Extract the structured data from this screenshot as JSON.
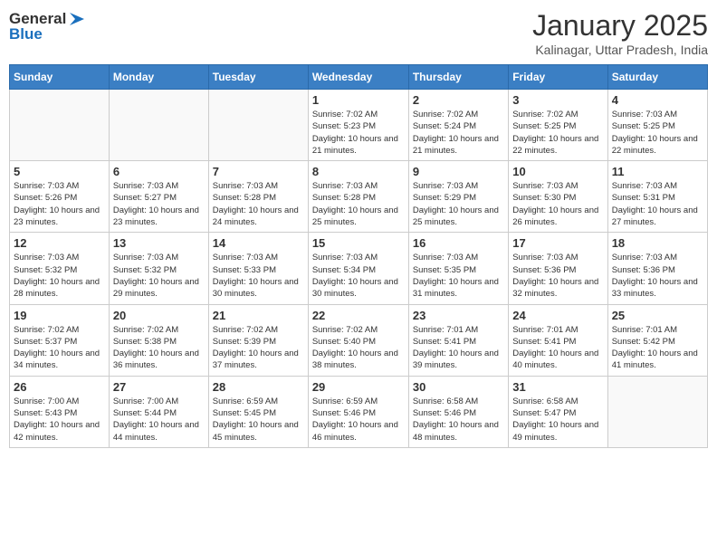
{
  "header": {
    "logo_general": "General",
    "logo_blue": "Blue",
    "title": "January 2025",
    "subtitle": "Kalinagar, Uttar Pradesh, India"
  },
  "weekdays": [
    "Sunday",
    "Monday",
    "Tuesday",
    "Wednesday",
    "Thursday",
    "Friday",
    "Saturday"
  ],
  "weeks": [
    [
      {
        "day": "",
        "sunrise": "",
        "sunset": "",
        "daylight": ""
      },
      {
        "day": "",
        "sunrise": "",
        "sunset": "",
        "daylight": ""
      },
      {
        "day": "",
        "sunrise": "",
        "sunset": "",
        "daylight": ""
      },
      {
        "day": "1",
        "sunrise": "Sunrise: 7:02 AM",
        "sunset": "Sunset: 5:23 PM",
        "daylight": "Daylight: 10 hours and 21 minutes."
      },
      {
        "day": "2",
        "sunrise": "Sunrise: 7:02 AM",
        "sunset": "Sunset: 5:24 PM",
        "daylight": "Daylight: 10 hours and 21 minutes."
      },
      {
        "day": "3",
        "sunrise": "Sunrise: 7:02 AM",
        "sunset": "Sunset: 5:25 PM",
        "daylight": "Daylight: 10 hours and 22 minutes."
      },
      {
        "day": "4",
        "sunrise": "Sunrise: 7:03 AM",
        "sunset": "Sunset: 5:25 PM",
        "daylight": "Daylight: 10 hours and 22 minutes."
      }
    ],
    [
      {
        "day": "5",
        "sunrise": "Sunrise: 7:03 AM",
        "sunset": "Sunset: 5:26 PM",
        "daylight": "Daylight: 10 hours and 23 minutes."
      },
      {
        "day": "6",
        "sunrise": "Sunrise: 7:03 AM",
        "sunset": "Sunset: 5:27 PM",
        "daylight": "Daylight: 10 hours and 23 minutes."
      },
      {
        "day": "7",
        "sunrise": "Sunrise: 7:03 AM",
        "sunset": "Sunset: 5:28 PM",
        "daylight": "Daylight: 10 hours and 24 minutes."
      },
      {
        "day": "8",
        "sunrise": "Sunrise: 7:03 AM",
        "sunset": "Sunset: 5:28 PM",
        "daylight": "Daylight: 10 hours and 25 minutes."
      },
      {
        "day": "9",
        "sunrise": "Sunrise: 7:03 AM",
        "sunset": "Sunset: 5:29 PM",
        "daylight": "Daylight: 10 hours and 25 minutes."
      },
      {
        "day": "10",
        "sunrise": "Sunrise: 7:03 AM",
        "sunset": "Sunset: 5:30 PM",
        "daylight": "Daylight: 10 hours and 26 minutes."
      },
      {
        "day": "11",
        "sunrise": "Sunrise: 7:03 AM",
        "sunset": "Sunset: 5:31 PM",
        "daylight": "Daylight: 10 hours and 27 minutes."
      }
    ],
    [
      {
        "day": "12",
        "sunrise": "Sunrise: 7:03 AM",
        "sunset": "Sunset: 5:32 PM",
        "daylight": "Daylight: 10 hours and 28 minutes."
      },
      {
        "day": "13",
        "sunrise": "Sunrise: 7:03 AM",
        "sunset": "Sunset: 5:32 PM",
        "daylight": "Daylight: 10 hours and 29 minutes."
      },
      {
        "day": "14",
        "sunrise": "Sunrise: 7:03 AM",
        "sunset": "Sunset: 5:33 PM",
        "daylight": "Daylight: 10 hours and 30 minutes."
      },
      {
        "day": "15",
        "sunrise": "Sunrise: 7:03 AM",
        "sunset": "Sunset: 5:34 PM",
        "daylight": "Daylight: 10 hours and 30 minutes."
      },
      {
        "day": "16",
        "sunrise": "Sunrise: 7:03 AM",
        "sunset": "Sunset: 5:35 PM",
        "daylight": "Daylight: 10 hours and 31 minutes."
      },
      {
        "day": "17",
        "sunrise": "Sunrise: 7:03 AM",
        "sunset": "Sunset: 5:36 PM",
        "daylight": "Daylight: 10 hours and 32 minutes."
      },
      {
        "day": "18",
        "sunrise": "Sunrise: 7:03 AM",
        "sunset": "Sunset: 5:36 PM",
        "daylight": "Daylight: 10 hours and 33 minutes."
      }
    ],
    [
      {
        "day": "19",
        "sunrise": "Sunrise: 7:02 AM",
        "sunset": "Sunset: 5:37 PM",
        "daylight": "Daylight: 10 hours and 34 minutes."
      },
      {
        "day": "20",
        "sunrise": "Sunrise: 7:02 AM",
        "sunset": "Sunset: 5:38 PM",
        "daylight": "Daylight: 10 hours and 36 minutes."
      },
      {
        "day": "21",
        "sunrise": "Sunrise: 7:02 AM",
        "sunset": "Sunset: 5:39 PM",
        "daylight": "Daylight: 10 hours and 37 minutes."
      },
      {
        "day": "22",
        "sunrise": "Sunrise: 7:02 AM",
        "sunset": "Sunset: 5:40 PM",
        "daylight": "Daylight: 10 hours and 38 minutes."
      },
      {
        "day": "23",
        "sunrise": "Sunrise: 7:01 AM",
        "sunset": "Sunset: 5:41 PM",
        "daylight": "Daylight: 10 hours and 39 minutes."
      },
      {
        "day": "24",
        "sunrise": "Sunrise: 7:01 AM",
        "sunset": "Sunset: 5:41 PM",
        "daylight": "Daylight: 10 hours and 40 minutes."
      },
      {
        "day": "25",
        "sunrise": "Sunrise: 7:01 AM",
        "sunset": "Sunset: 5:42 PM",
        "daylight": "Daylight: 10 hours and 41 minutes."
      }
    ],
    [
      {
        "day": "26",
        "sunrise": "Sunrise: 7:00 AM",
        "sunset": "Sunset: 5:43 PM",
        "daylight": "Daylight: 10 hours and 42 minutes."
      },
      {
        "day": "27",
        "sunrise": "Sunrise: 7:00 AM",
        "sunset": "Sunset: 5:44 PM",
        "daylight": "Daylight: 10 hours and 44 minutes."
      },
      {
        "day": "28",
        "sunrise": "Sunrise: 6:59 AM",
        "sunset": "Sunset: 5:45 PM",
        "daylight": "Daylight: 10 hours and 45 minutes."
      },
      {
        "day": "29",
        "sunrise": "Sunrise: 6:59 AM",
        "sunset": "Sunset: 5:46 PM",
        "daylight": "Daylight: 10 hours and 46 minutes."
      },
      {
        "day": "30",
        "sunrise": "Sunrise: 6:58 AM",
        "sunset": "Sunset: 5:46 PM",
        "daylight": "Daylight: 10 hours and 48 minutes."
      },
      {
        "day": "31",
        "sunrise": "Sunrise: 6:58 AM",
        "sunset": "Sunset: 5:47 PM",
        "daylight": "Daylight: 10 hours and 49 minutes."
      },
      {
        "day": "",
        "sunrise": "",
        "sunset": "",
        "daylight": ""
      }
    ]
  ]
}
